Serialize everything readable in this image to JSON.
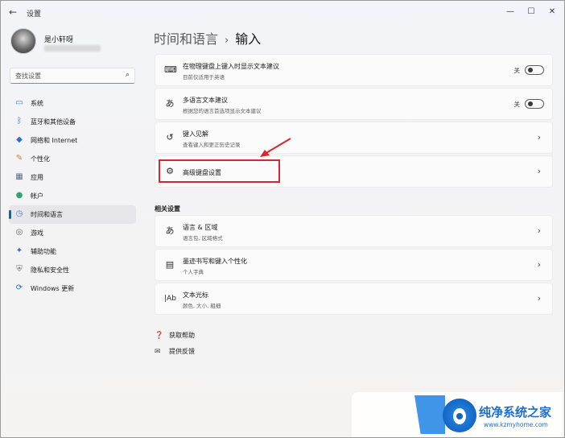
{
  "window": {
    "title": "设置",
    "back_icon": "back-arrow-icon"
  },
  "profile": {
    "name": "是小轩呀"
  },
  "search": {
    "placeholder": "查找设置"
  },
  "sidebar": {
    "items": [
      {
        "label": "系统",
        "icon": "monitor-icon",
        "color": "#3a7bd5",
        "active": false
      },
      {
        "label": "蓝牙和其他设备",
        "icon": "bluetooth-icon",
        "color": "#2f6fc7",
        "active": false
      },
      {
        "label": "网络和 Internet",
        "icon": "wifi-icon",
        "color": "#2f6fc7",
        "active": false
      },
      {
        "label": "个性化",
        "icon": "brush-icon",
        "color": "#d27a2c",
        "active": false
      },
      {
        "label": "应用",
        "icon": "apps-icon",
        "color": "#5b6e88",
        "active": false
      },
      {
        "label": "帐户",
        "icon": "person-icon",
        "color": "#2fa36b",
        "active": false
      },
      {
        "label": "时间和语言",
        "icon": "clock-globe-icon",
        "color": "#3a7bd5",
        "active": true
      },
      {
        "label": "游戏",
        "icon": "gamepad-icon",
        "color": "#6b6b6b",
        "active": false
      },
      {
        "label": "辅助功能",
        "icon": "accessibility-icon",
        "color": "#2f6fc7",
        "active": false
      },
      {
        "label": "隐私和安全性",
        "icon": "shield-icon",
        "color": "#6b6b6b",
        "active": false
      },
      {
        "label": "Windows 更新",
        "icon": "update-icon",
        "color": "#2f6fc7",
        "active": false
      }
    ]
  },
  "breadcrumb": {
    "parent": "时间和语言",
    "separator": "›",
    "current": "输入"
  },
  "cards": [
    {
      "title": "在物理键盘上键入时显示文本建议",
      "subtitle": "目前仅适用于英语",
      "icon": "keyboard-icon",
      "toggle_label": "关",
      "toggle_on": false
    },
    {
      "title": "多语言文本建议",
      "subtitle": "根据您的语言首选项显示文本建议",
      "icon": "language-icon",
      "toggle_label": "关",
      "toggle_on": false
    },
    {
      "title": "键入见解",
      "subtitle": "查看键入和更正历史记录",
      "icon": "history-icon"
    },
    {
      "title": "高级键盘设置",
      "subtitle": "",
      "icon": "gear-icon"
    }
  ],
  "related": {
    "title": "相关设置",
    "cards": [
      {
        "title": "语言 & 区域",
        "subtitle": "语言包, 区域格式",
        "icon": "language-icon"
      },
      {
        "title": "墨迹书写和键入个性化",
        "subtitle": "个人字典",
        "icon": "notebook-icon"
      },
      {
        "title": "文本光标",
        "subtitle": "颜色, 大小, 粗细",
        "icon": "text-cursor-icon"
      }
    ]
  },
  "links": {
    "help": "获取帮助",
    "feedback": "提供反馈"
  },
  "watermark": {
    "title": "纯净系统之家",
    "url": "www.kzmyhome.com"
  },
  "colors": {
    "accent": "#0067c0",
    "highlight": "#d7282f"
  }
}
